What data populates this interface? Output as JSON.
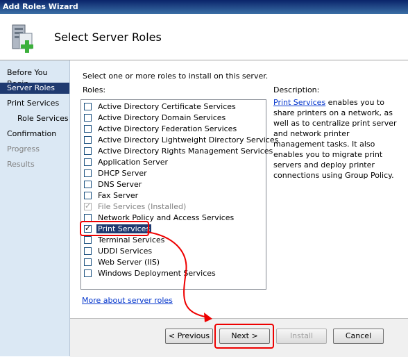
{
  "window": {
    "title": "Add Roles Wizard"
  },
  "header": {
    "heading": "Select Server Roles"
  },
  "sidebar": {
    "items": [
      {
        "label": "Before You Begin",
        "state": "normal"
      },
      {
        "label": "Server Roles",
        "state": "selected"
      },
      {
        "label": "Print Services",
        "state": "normal"
      },
      {
        "label": "Role Services",
        "state": "normal"
      },
      {
        "label": "Confirmation",
        "state": "normal"
      },
      {
        "label": "Progress",
        "state": "disabled"
      },
      {
        "label": "Results",
        "state": "disabled"
      }
    ]
  },
  "main": {
    "instruction": "Select one or more roles to install on this server.",
    "roles_label": "Roles:",
    "roles": [
      {
        "label": "Active Directory Certificate Services",
        "checked": false
      },
      {
        "label": "Active Directory Domain Services",
        "checked": false
      },
      {
        "label": "Active Directory Federation Services",
        "checked": false
      },
      {
        "label": "Active Directory Lightweight Directory Services",
        "checked": false
      },
      {
        "label": "Active Directory Rights Management Services",
        "checked": false
      },
      {
        "label": "Application Server",
        "checked": false
      },
      {
        "label": "DHCP Server",
        "checked": false
      },
      {
        "label": "DNS Server",
        "checked": false
      },
      {
        "label": "Fax Server",
        "checked": false
      },
      {
        "label": "File Services  (Installed)",
        "checked": true,
        "disabled": true
      },
      {
        "label": "Network Policy and Access Services",
        "checked": false
      },
      {
        "label": "Print Services",
        "checked": true,
        "selected": true
      },
      {
        "label": "Terminal Services",
        "checked": false
      },
      {
        "label": "UDDI Services",
        "checked": false
      },
      {
        "label": "Web Server (IIS)",
        "checked": false
      },
      {
        "label": "Windows Deployment Services",
        "checked": false
      }
    ],
    "more_link": "More about server roles",
    "description_label": "Description:",
    "description_link": "Print Services",
    "description_text": " enables you to share printers on a network, as well as to centralize print server and network printer management tasks. It also enables you to migrate print servers and deploy printer connections using Group Policy."
  },
  "footer": {
    "previous_label": "< Previous",
    "next_label": "Next >",
    "install_label": "Install",
    "cancel_label": "Cancel"
  },
  "colors": {
    "highlight": "#e00000",
    "selection": "#1f3a70",
    "sidebar_bg": "#dbe8f4"
  }
}
